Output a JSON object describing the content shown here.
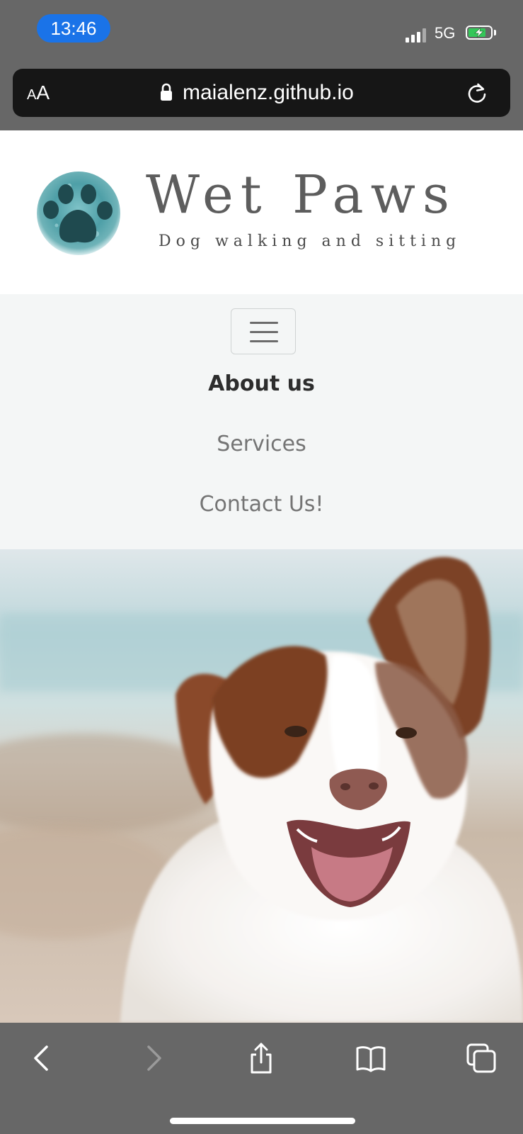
{
  "status_bar": {
    "time": "13:46",
    "network": "5G",
    "time_pill_color": "#1a73e8",
    "battery_color": "#34c759",
    "battery_level": 0.8,
    "charging": true
  },
  "browser": {
    "text_size_small": "A",
    "text_size_large": "A",
    "url": "maialenz.github.io",
    "lock_icon": "lock-icon",
    "reload_icon": "reload-icon"
  },
  "site": {
    "title": "Wet Paws",
    "tagline": "Dog walking and sitting",
    "logo_icon": "paw-print-icon",
    "nav": {
      "toggle_icon": "hamburger-menu-icon",
      "links": [
        {
          "label": "About us",
          "active": true
        },
        {
          "label": "Services",
          "active": false
        },
        {
          "label": "Contact Us!",
          "active": false
        }
      ]
    },
    "hero_image": "dog-photo"
  },
  "toolbar": {
    "icons": [
      "back-icon",
      "forward-icon",
      "share-icon",
      "bookmarks-icon",
      "tabs-icon"
    ]
  }
}
